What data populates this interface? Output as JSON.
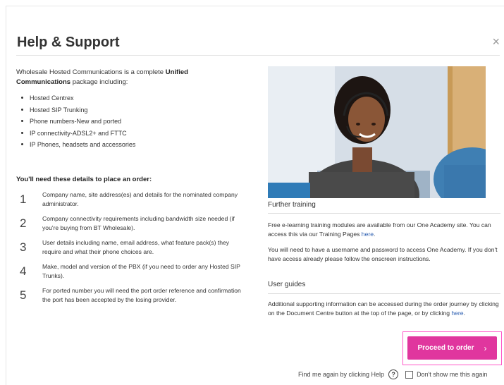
{
  "dialog": {
    "title": "Help & Support",
    "close_symbol": "×"
  },
  "intro": {
    "text_before": "Wholesale Hosted Communications is a complete ",
    "bold": "Unified Communications",
    "text_after": " package including:"
  },
  "bullets": [
    "Hosted Centrex",
    "Hosted SIP Trunking",
    "Phone numbers-New and ported",
    "IP connectivity-ADSL2+ and FTTC",
    "IP Phones, headsets and accessories"
  ],
  "steps_title": "You'll need these details to place an order:",
  "steps": [
    {
      "num": "1",
      "text": "Company name, site address(es) and details for the nominated company administrator."
    },
    {
      "num": "2",
      "text": "Company connectivity requirements including bandwidth size needed (if you're buying from BT Wholesale)."
    },
    {
      "num": "3",
      "text": "User details including name, email address, what feature pack(s) they require and what their phone choices are."
    },
    {
      "num": "4",
      "text": "Make, model and version of the PBX (if you need to order any Hosted SIP Trunks)."
    },
    {
      "num": "5",
      "text": "For ported number you will need the port order reference and confirmation the port has been accepted by the losing provider."
    }
  ],
  "further_training": {
    "heading": "Further training",
    "p1_before": "Free e-learning training modules are available from our One Academy site. You can access this via our Training Pages ",
    "p1_link": "here",
    "p1_after": ".",
    "p2": "You will need to have a username and password to access One Academy. If you don't have access already please follow the onscreen instructions."
  },
  "user_guides": {
    "heading": "User guides",
    "p_before": "Additional supporting information can be accessed during the order journey by clicking on the Document Centre button at the top of the page, or by clicking ",
    "p_link": "here",
    "p_after": "."
  },
  "proceed_button": {
    "label": "Proceed to order",
    "chevron": "›"
  },
  "footer": {
    "find_help": "Find me again by clicking Help",
    "help_symbol": "?",
    "dont_show": "Don't show me this again"
  },
  "colors": {
    "accent": "#e0369e",
    "link": "#2a5db0"
  }
}
